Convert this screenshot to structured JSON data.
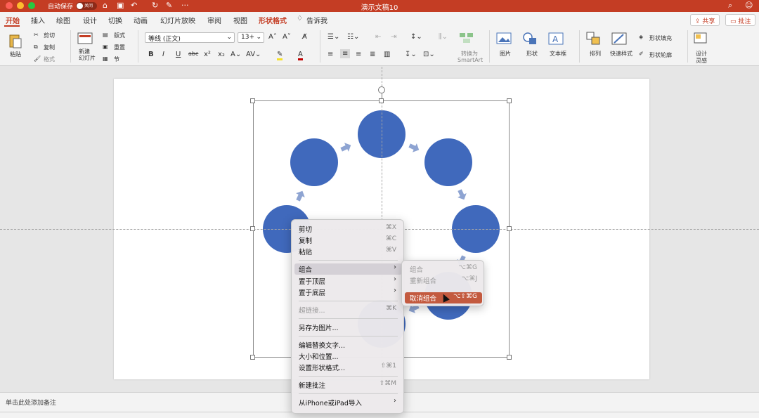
{
  "titlebar": {
    "autosave_label": "自动保存",
    "autosave_state": "关闭",
    "doc_title": "演示文稿10",
    "more": "···"
  },
  "tabs": [
    {
      "label": "开始"
    },
    {
      "label": "插入"
    },
    {
      "label": "绘图"
    },
    {
      "label": "设计"
    },
    {
      "label": "切换"
    },
    {
      "label": "动画"
    },
    {
      "label": "幻灯片放映"
    },
    {
      "label": "审阅"
    },
    {
      "label": "视图"
    },
    {
      "label": "形状格式"
    },
    {
      "label": "告诉我"
    }
  ],
  "header_buttons": {
    "share": "共享",
    "comment": "批注"
  },
  "ribbon": {
    "paste": "粘贴",
    "cut": "剪切",
    "copy": "复制",
    "format_painter": "格式",
    "new_slide": "新建\n幻灯片",
    "layout": "版式",
    "reset": "重置",
    "section": "节",
    "font_name": "等线 (正文)",
    "font_size": "13+",
    "convert_smartart_1": "转换为",
    "convert_smartart_2": "SmartArt",
    "picture": "图片",
    "shapes": "形状",
    "textbox": "文本框",
    "arrange": "排列",
    "quick_styles": "快速样式",
    "shape_fill": "形状填充",
    "shape_outline": "形状轮廓",
    "design_ideas_1": "设计",
    "design_ideas_2": "灵感",
    "bold": "B",
    "italic": "I",
    "underline": "U",
    "strike": "abc",
    "superscript": "x²",
    "subscript": "x₂"
  },
  "notes": {
    "placeholder": "单击此处添加备注"
  },
  "context_menu": {
    "items": [
      {
        "label": "剪切",
        "shortcut": "⌘X"
      },
      {
        "label": "复制",
        "shortcut": "⌘C"
      },
      {
        "label": "粘贴",
        "shortcut": "⌘V"
      },
      {
        "label": "组合",
        "shortcut": "",
        "submenu": true
      },
      {
        "label": "置于顶层",
        "shortcut": "",
        "submenu": true
      },
      {
        "label": "置于底层",
        "shortcut": "",
        "submenu": true
      },
      {
        "label": "超链接...",
        "shortcut": "⌘K"
      },
      {
        "label": "另存为图片...",
        "shortcut": ""
      },
      {
        "label": "编辑替换文字...",
        "shortcut": ""
      },
      {
        "label": "大小和位置...",
        "shortcut": ""
      },
      {
        "label": "设置形状格式...",
        "shortcut": "⇧⌘1"
      },
      {
        "label": "新建批注",
        "shortcut": "⇧⌘M"
      },
      {
        "label": "从iPhone或iPad导入",
        "shortcut": "",
        "submenu": true
      }
    ]
  },
  "submenu": {
    "items": [
      {
        "label": "组合",
        "shortcut": "⌥⌘G"
      },
      {
        "label": "重新组合",
        "shortcut": "⌥⌘J"
      },
      {
        "label": "取消组合",
        "shortcut": "⌥⇧⌘G"
      }
    ]
  },
  "colors": {
    "accent": "#c43d24",
    "shape_fill": "#4069bc",
    "arrow_fill": "#8ea4d2"
  }
}
